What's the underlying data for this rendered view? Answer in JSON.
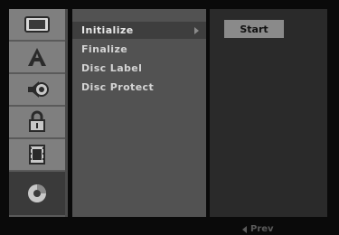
{
  "sidebar": {
    "items": [
      {
        "icon": "tv-screen-icon"
      },
      {
        "icon": "letter-a-icon"
      },
      {
        "icon": "speaker-icon"
      },
      {
        "icon": "lock-icon"
      },
      {
        "icon": "film-icon"
      },
      {
        "icon": "disc-icon",
        "active": true
      }
    ]
  },
  "menu": {
    "items": [
      {
        "label": "Initialize",
        "selected": true
      },
      {
        "label": "Finalize"
      },
      {
        "label": "Disc Label"
      },
      {
        "label": "Disc Protect"
      }
    ]
  },
  "panel": {
    "start_label": "Start"
  },
  "footer": {
    "prev_label": "Prev"
  }
}
